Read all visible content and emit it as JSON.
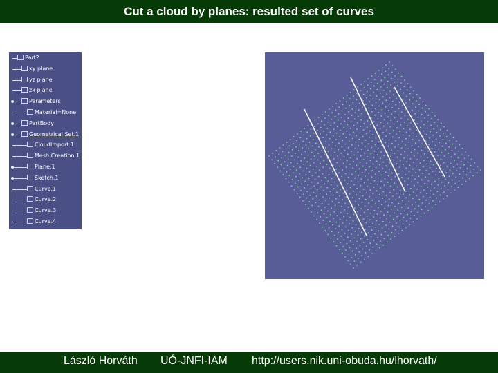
{
  "header": {
    "title": "Cut a cloud by planes: resulted set of curves"
  },
  "footer": {
    "author": "László Horváth",
    "institute": "UÓ-JNFI-IAM",
    "url": "http://users.nik.uni-obuda.hu/lhorvath/"
  },
  "tree": {
    "items": [
      {
        "label": "Part2",
        "icon": "part-icon",
        "level": 0
      },
      {
        "label": "xy plane",
        "icon": "plane-icon",
        "level": 1
      },
      {
        "label": "yz plane",
        "icon": "plane-icon",
        "level": 1
      },
      {
        "label": "zx plane",
        "icon": "plane-icon",
        "level": 1
      },
      {
        "label": "Parameters",
        "icon": "parameters-icon",
        "level": 1
      },
      {
        "label": "Material=None",
        "icon": "material-icon",
        "level": 2
      },
      {
        "label": "PartBody",
        "icon": "body-icon",
        "level": 1
      },
      {
        "label": "Geometrical Set.1",
        "icon": "geoset-icon",
        "level": 1,
        "selected": true
      },
      {
        "label": "CloudImport.1",
        "icon": "cloud-icon",
        "level": 2
      },
      {
        "label": "Mesh Creation.1",
        "icon": "mesh-icon",
        "level": 2
      },
      {
        "label": "Plane.1",
        "icon": "plane-icon",
        "level": 2
      },
      {
        "label": "Sketch.1",
        "icon": "sketch-icon",
        "level": 2
      },
      {
        "label": "Curve.1",
        "icon": "curve-icon",
        "level": 2
      },
      {
        "label": "Curve.2",
        "icon": "curve-icon",
        "level": 2
      },
      {
        "label": "Curve.3",
        "icon": "curve-icon",
        "level": 2
      },
      {
        "label": "Curve.4",
        "icon": "curve-icon",
        "level": 2
      }
    ]
  },
  "viewport": {
    "background": "#595d97",
    "point_color": "#7fd6a0",
    "curve_color": "#f4f4f4"
  },
  "colors": {
    "header_bg": "#063a06",
    "tree_bg": "#4a4f86"
  }
}
